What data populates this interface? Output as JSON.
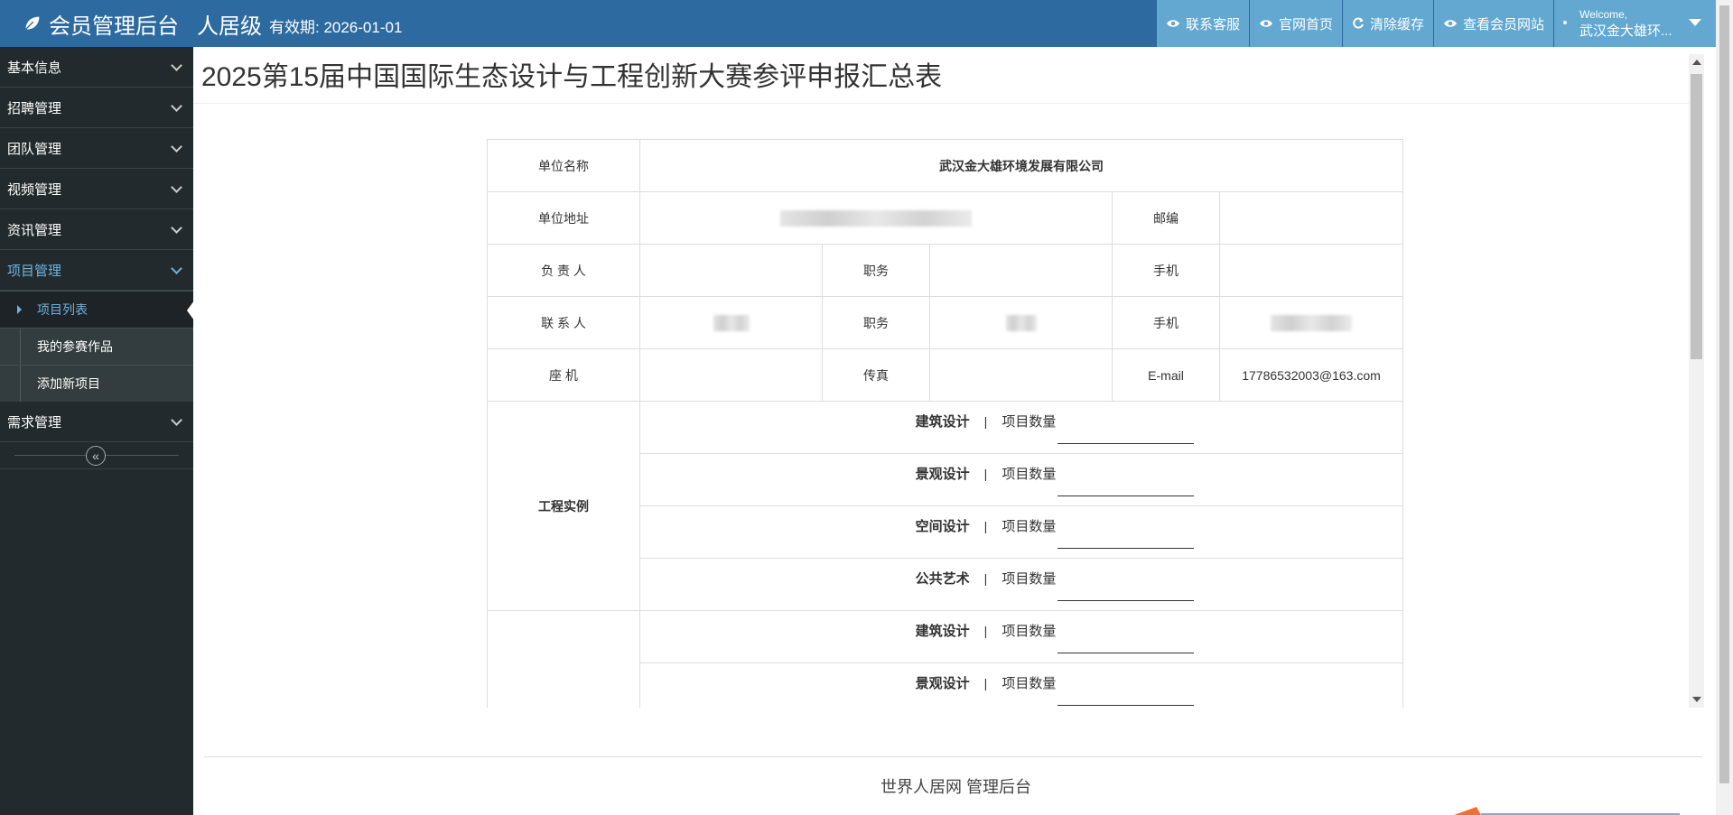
{
  "navbar": {
    "brand": "会员管理后台",
    "level": "人居级",
    "validity": "有效期: 2026-01-01",
    "buttons": [
      {
        "label": "联系客服",
        "icon": "eye-icon"
      },
      {
        "label": "官网首页",
        "icon": "eye-icon"
      },
      {
        "label": "清除缓存",
        "icon": "refresh-icon"
      },
      {
        "label": "查看会员网站",
        "icon": "eye-icon"
      }
    ],
    "user": {
      "welcome": "Welcome,",
      "name": "武汉金大雄环..."
    }
  },
  "sidebar": {
    "items": [
      {
        "label": "基本信息"
      },
      {
        "label": "招聘管理"
      },
      {
        "label": "团队管理"
      },
      {
        "label": "视频管理"
      },
      {
        "label": "资讯管理"
      },
      {
        "label": "项目管理"
      },
      {
        "label": "需求管理"
      }
    ],
    "subitems": [
      {
        "label": "项目列表"
      },
      {
        "label": "我的参赛作品"
      },
      {
        "label": "添加新项目"
      }
    ],
    "collapse_icon": "«"
  },
  "main": {
    "title": "2025第15届中国国际生态设计与工程创新大赛参评申报汇总表",
    "form": {
      "unit_name_label": "单位名称",
      "unit_name": "武汉金大雄环境发展有限公司",
      "unit_address_label": "单位地址",
      "postcode_label": "邮编",
      "person_in_charge_label": "负 责 人",
      "position_label": "职务",
      "mobile_label": "手机",
      "contact_label": "联 系 人",
      "landline_label": "座 机",
      "fax_label": "传真",
      "email_label": "E-mail",
      "email": "17786532003@163.com",
      "engineering_label": "工程实例",
      "separator": "|",
      "quantity_label": "项目数量",
      "categories_a": [
        "建筑设计",
        "景观设计",
        "空间设计",
        "公共艺术"
      ],
      "categories_b": [
        "建筑设计",
        "景观设计"
      ]
    }
  },
  "footer": {
    "text": "世界人居网 管理后台"
  },
  "colors": {
    "navbar": "#2c6aa0",
    "navbtn": "#62a8d1",
    "sidebar": "#222a2d",
    "active": "#6fb3e0"
  }
}
